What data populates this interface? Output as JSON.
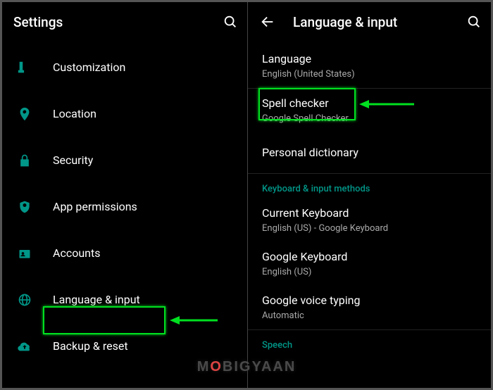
{
  "left": {
    "title": "Settings",
    "items": [
      {
        "icon": "brush",
        "label": "Customization"
      },
      {
        "icon": "place",
        "label": "Location"
      },
      {
        "icon": "lock",
        "label": "Security"
      },
      {
        "icon": "shield",
        "label": "App permissions"
      },
      {
        "icon": "account",
        "label": "Accounts"
      },
      {
        "icon": "globe",
        "label": "Language & input"
      },
      {
        "icon": "cloud",
        "label": "Backup & reset"
      }
    ]
  },
  "right": {
    "title": "Language & input",
    "items": [
      {
        "label": "Language",
        "sub": "English (United States)"
      },
      {
        "label": "Spell checker",
        "sub": "Google Spell Checker"
      },
      {
        "label": "Personal dictionary"
      }
    ],
    "section_header": "Keyboard & input methods",
    "section_items": [
      {
        "label": "Current Keyboard",
        "sub": "English (US) - Google Keyboard"
      },
      {
        "label": "Google Keyboard",
        "sub": "English (US)"
      },
      {
        "label": "Google voice typing",
        "sub": "Automatic"
      }
    ],
    "section2_header": "Speech"
  },
  "watermark": "MOBIGYAAN"
}
